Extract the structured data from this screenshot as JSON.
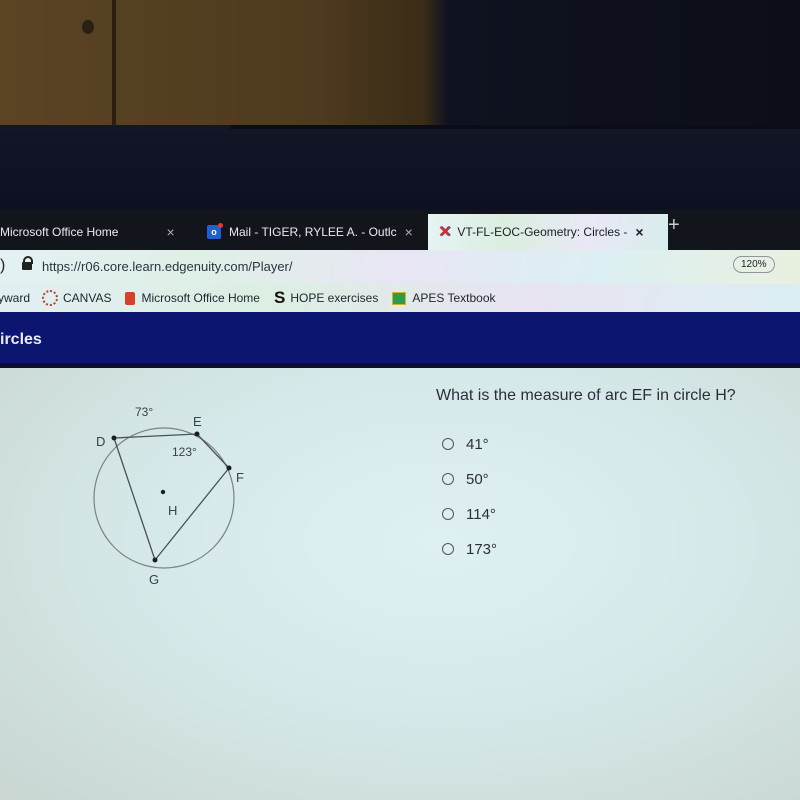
{
  "browser": {
    "tabs": [
      {
        "label": "Microsoft Office Home",
        "icon": "none",
        "active": false
      },
      {
        "label": "Mail - TIGER, RYLEE A. - Outlc",
        "icon": "outlook-icon",
        "active": false
      },
      {
        "label": "VT-FL-EOC-Geometry: Circles -",
        "icon": "edgenuity-x-icon",
        "active": true
      }
    ],
    "close_glyph": "×",
    "new_tab_glyph": "+",
    "url": "https://r06.core.learn.edgenuity.com/Player/",
    "zoom_level": "120%",
    "bookmarks": [
      {
        "label": "yward",
        "icon": "none"
      },
      {
        "label": "CANVAS",
        "icon": "canvas-icon"
      },
      {
        "label": "Microsoft Office Home",
        "icon": "office-icon"
      },
      {
        "label": "HOPE exercises",
        "icon": "s-icon"
      },
      {
        "label": "APES Textbook",
        "icon": "classroom-icon"
      }
    ]
  },
  "page": {
    "header_title": "ircles",
    "question": "What is the measure of arc EF in circle H?",
    "choices": [
      {
        "label": "41°",
        "selected": false
      },
      {
        "label": "50°",
        "selected": false
      },
      {
        "label": "114°",
        "selected": false
      },
      {
        "label": "173°",
        "selected": false
      }
    ],
    "diagram": {
      "points": {
        "D": "D",
        "E": "E",
        "F": "F",
        "G": "G",
        "H": "H"
      },
      "arc_DE_label": "73°",
      "arc_EF_label": "123°"
    }
  }
}
